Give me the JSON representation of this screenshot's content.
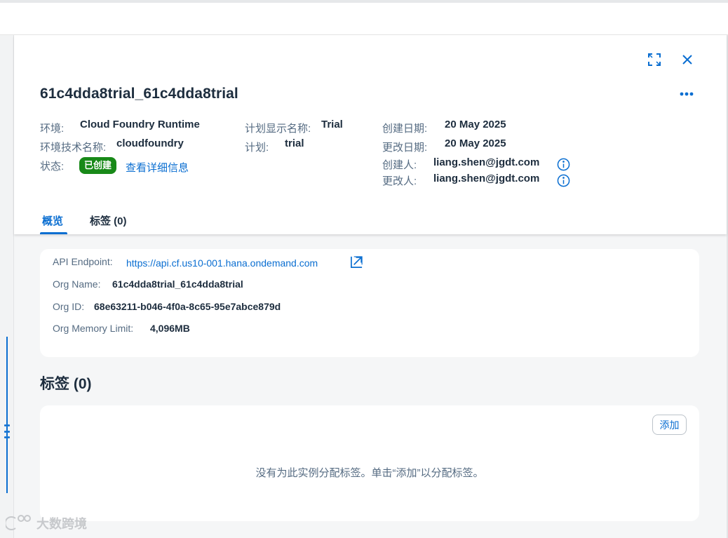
{
  "header": {
    "title": "61c4dda8trial_61c4dda8trial",
    "fields": {
      "environment_label": "环境:",
      "environment_value": "Cloud Foundry Runtime",
      "env_tech_name_label": "环境技术名称:",
      "env_tech_name_value": "cloudfoundry",
      "status_label": "状态:",
      "status_badge": "已创建",
      "details_link": "查看详细信息",
      "plan_display_label": "计划显示名称:",
      "plan_display_value": "Trial",
      "plan_label": "计划:",
      "plan_value": "trial",
      "created_date_label": "创建日期:",
      "created_date_value": "20 May 2025",
      "changed_date_label": "更改日期:",
      "changed_date_value": "20 May 2025",
      "created_by_label": "创建人:",
      "created_by_value": "liang.shen@jgdt.com",
      "changed_by_label": "更改人:",
      "changed_by_value": "liang.shen@jgdt.com"
    },
    "tabs": [
      {
        "label": "概览",
        "active": true
      },
      {
        "label": "标签 (0)",
        "active": false
      }
    ]
  },
  "overview": {
    "api_endpoint_label": "API Endpoint:",
    "api_endpoint_value": "https://api.cf.us10-001.hana.ondemand.com",
    "org_name_label": "Org Name:",
    "org_name_value": "61c4dda8trial_61c4dda8trial",
    "org_id_label": "Org ID:",
    "org_id_value": "68e63211-b046-4f0a-8c65-95e7abce879d",
    "org_memory_label": "Org Memory Limit:",
    "org_memory_value": "4,096MB"
  },
  "labels_section": {
    "title": "标签 (0)",
    "add_button": "添加",
    "empty_message": "没有为此实例分配标签。单击“添加”以分配标签。"
  },
  "watermark": {
    "text": "大数跨境"
  },
  "colors": {
    "accent": "#0a6ed1",
    "status_success": "#188918",
    "text_primary": "#1d2d3e",
    "text_secondary": "#556b82",
    "background": "#f5f6f7"
  },
  "icons": [
    "fullscreen-icon",
    "close-icon",
    "more-icon",
    "info-icon",
    "external-link-icon",
    "splitter-grip-icon"
  ]
}
